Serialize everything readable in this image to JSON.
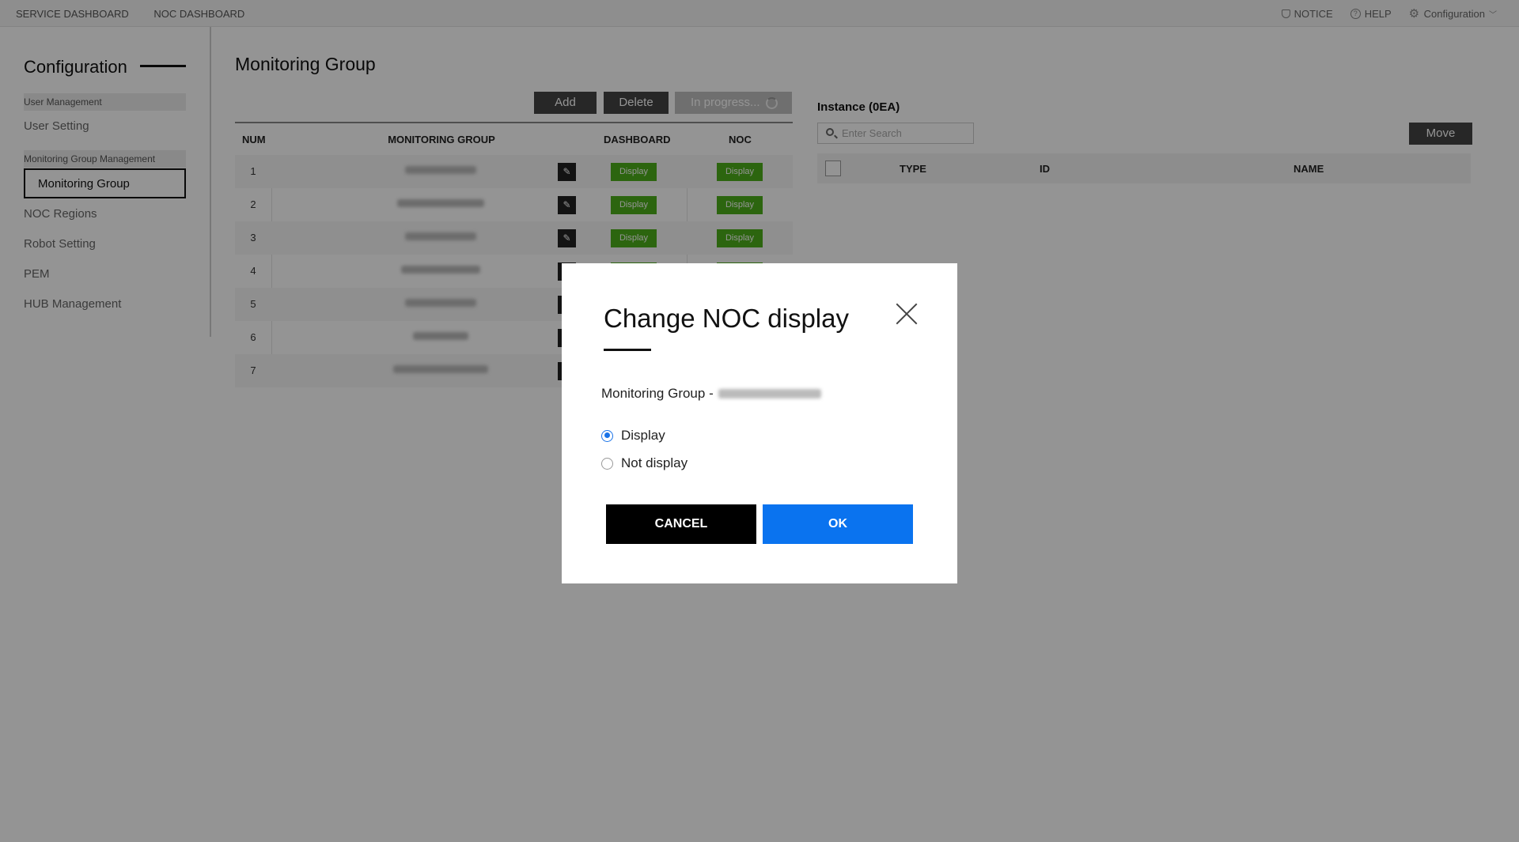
{
  "topbar": {
    "nav": [
      "SERVICE DASHBOARD",
      "NOC DASHBOARD"
    ],
    "notice": "NOTICE",
    "help": "HELP",
    "config": "Configuration"
  },
  "sidebar": {
    "title": "Configuration",
    "sections": [
      {
        "label": "User Management",
        "items": [
          "User Setting"
        ]
      },
      {
        "label": "Monitoring Group Management",
        "items": [
          "Monitoring Group"
        ]
      }
    ],
    "active": "Monitoring Group",
    "items": [
      "NOC Regions",
      "Robot Setting",
      "PEM",
      "HUB Management"
    ]
  },
  "main": {
    "title": "Monitoring Group",
    "buttons": {
      "add": "Add",
      "delete": "Delete",
      "progress": "In progress..."
    },
    "table": {
      "headers": [
        "NUM",
        "MONITORING GROUP",
        "DASHBOARD",
        "NOC"
      ],
      "display_label": "Display",
      "rows": [
        {
          "num": "1"
        },
        {
          "num": "2"
        },
        {
          "num": "3"
        },
        {
          "num": "4"
        },
        {
          "num": "5"
        },
        {
          "num": "6"
        },
        {
          "num": "7"
        }
      ]
    }
  },
  "instance": {
    "title": "Instance (0EA)",
    "search_placeholder": "Enter Search",
    "move": "Move",
    "headers": [
      "TYPE",
      "ID",
      "NAME"
    ]
  },
  "modal": {
    "title": "Change NOC display",
    "subtitle": "Monitoring Group -",
    "options": [
      {
        "label": "Display",
        "selected": true
      },
      {
        "label": "Not display",
        "selected": false
      }
    ],
    "cancel": "CANCEL",
    "ok": "OK",
    "colors": {
      "ok": "#0a73ef",
      "cancel": "#000000",
      "radio": "#1a73e8",
      "display_badge": "#4caf1a"
    }
  }
}
